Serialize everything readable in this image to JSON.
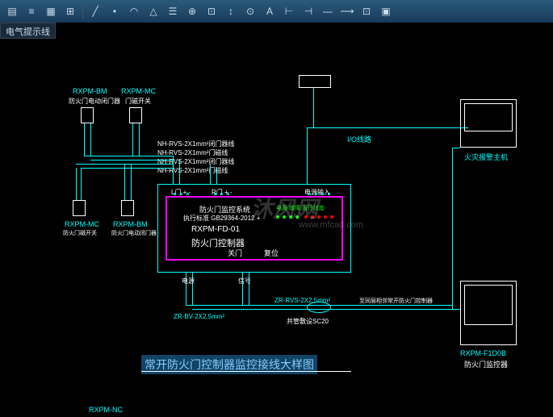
{
  "tab": {
    "label": "电气提示线"
  },
  "toolbar": {
    "icons": [
      "layers",
      "line",
      "pline",
      "circle",
      "arc",
      "rect",
      "hatch",
      "text",
      "dim",
      "move",
      "copy",
      "rotate",
      "mirror",
      "offset",
      "trim",
      "extend",
      "fillet",
      "array",
      "scale",
      "stretch"
    ]
  },
  "labels": {
    "rxpm_bm": "RXPM-BM",
    "rxpm_mc": "RXPM-MC",
    "bm_desc": "防火门电动闭门器",
    "mc_desc": "门磁开关",
    "rxpm_mc2": "RXPM-MC",
    "rxpm_bm2": "RXPM-BM",
    "mc2_desc": "防火门磁开关",
    "bm2_desc": "防火门电动闭门器",
    "cable1": "NH-RVS-2X1mm²闭门器线",
    "cable2": "NH-RVS-2X1mm²门磁线",
    "cable3": "NH-RVS-2X1mm²闭门器线",
    "cable4": "NH-RVS-2X1mm²门磁线",
    "io_line": "I/O线路",
    "host": "火灾报警主机",
    "ctrl_title1": "防火门监控系统",
    "ctrl_std": "执行标准 GB29364-2012 +",
    "ctrl_model": "RXPM-FD-01",
    "ctrl_name": "防火门控制器",
    "ctrl_close": "关门",
    "ctrl_reset": "复位",
    "terminal_l": "L门 + -",
    "terminal_r": "R门 + -",
    "terminal_pwr": "电源输入",
    "power": "电源",
    "signal": "信号",
    "zr_bv": "ZR-BV-2X2.5mm²",
    "zr_rvs": "ZR-RVS-2X2.5mm²",
    "conduit": "共管敷设SC20",
    "next_ctrl": "至同层相邻常开防火门控制器",
    "rxpm_f1dob": "RXPM-F1D0B",
    "monitor": "防火门监控器",
    "rxpm_nc": "RXPM-NC",
    "fault_led": "电源 故障 运行状态"
  },
  "title": "常开防火门控制器监控接线大样图",
  "watermark": {
    "text": "沐风网",
    "url": "www.mfcad.com"
  }
}
